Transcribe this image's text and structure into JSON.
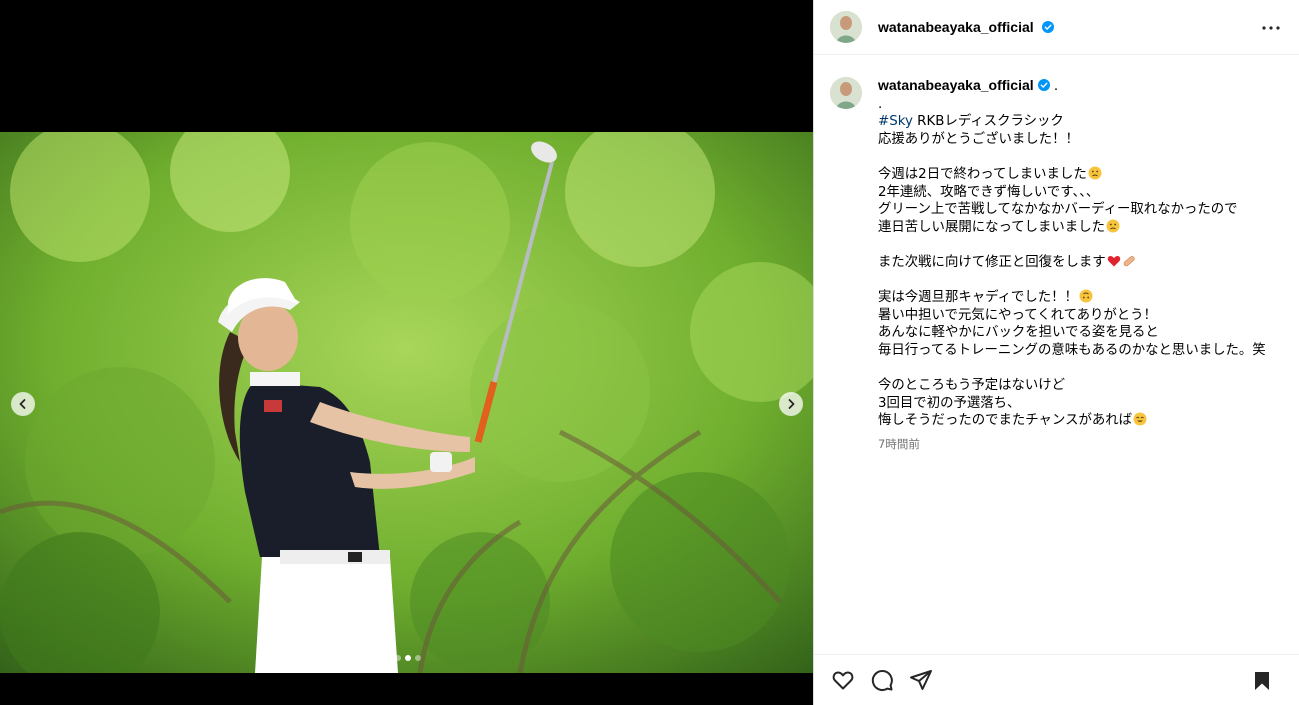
{
  "post": {
    "username": "watanabeayaka_official",
    "more_icon": "more-horizontal-icon",
    "verified_icon": "verified-badge-icon"
  },
  "caption": {
    "username": "watanabeayaka_official",
    "first_suffix": " .",
    "lines": [
      ".",
      "",
      "応援ありがとうございました！！",
      "",
      "今週は2日で終わってしまいました",
      "2年連続、攻略できず悔しいです、、、",
      "グリーン上で苦戦してなかなかバーディー取れなかったので",
      "連日苦しい展開になってしまいました",
      "",
      "また次戦に向けて修正と回復をします",
      "",
      "実は今週旦那キャディでした！！",
      "暑い中担いで元気にやってくれてありがとう！",
      "あんなに軽やかにバックを担いでる姿を見ると",
      "毎日行ってるトレーニングの意味もあるのかなと思いました。笑",
      "",
      "今のところもう予定はないけど",
      "3回目で初の予選落ち、",
      "悔しそうだったのでまたチャンスがあれば"
    ],
    "hashtag": "#Sky",
    "hashtag_rest": " RKBレディスクラシック",
    "timestamp": "7時間前"
  },
  "media": {
    "dots_total": 3,
    "active_dot": 2,
    "prev_icon": "chevron-left-icon",
    "next_icon": "chevron-right-icon"
  },
  "actions": {
    "like_icon": "heart-icon",
    "comment_icon": "comment-icon",
    "share_icon": "paper-plane-icon",
    "save_icon": "bookmark-icon"
  },
  "colors": {
    "hashtag": "#00376b",
    "verified": "#0095f6",
    "timestamp": "#737373"
  }
}
